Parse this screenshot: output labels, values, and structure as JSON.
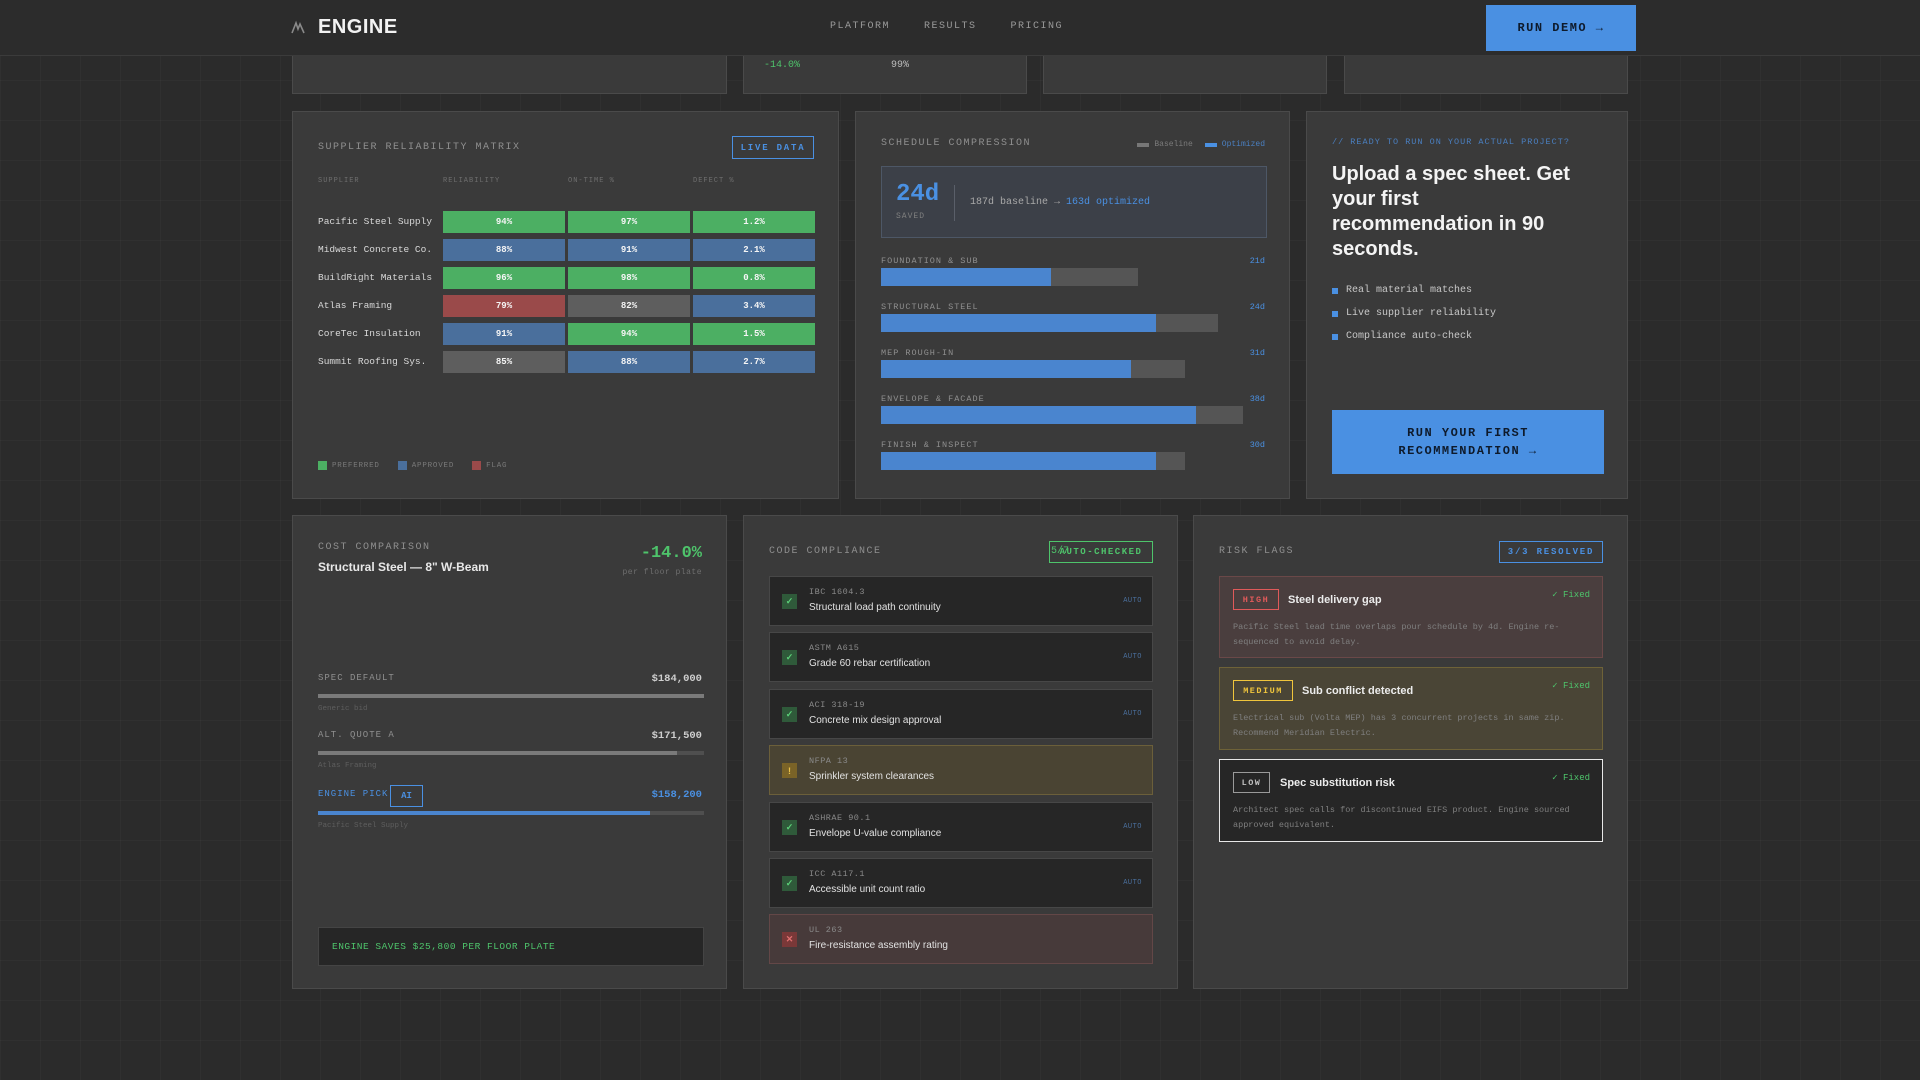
{
  "header": {
    "logo": "ENGINE",
    "nav": [
      "PLATFORM",
      "RESULTS",
      "PRICING"
    ],
    "demo_button": "RUN DEMO →"
  },
  "top_strip": {
    "change": "-14.0%",
    "percent": "99%"
  },
  "supplier_matrix": {
    "title": "SUPPLIER RELIABILITY MATRIX",
    "badge": "LIVE DATA",
    "columns": [
      "SUPPLIER",
      "RELIABILITY",
      "ON-TIME %",
      "DEFECT %"
    ],
    "rows": [
      {
        "name": "Pacific Steel Supply",
        "cells": [
          {
            "v": "94%",
            "s": "green"
          },
          {
            "v": "97%",
            "s": "green"
          },
          {
            "v": "1.2%",
            "s": "green"
          }
        ]
      },
      {
        "name": "Midwest Concrete Co.",
        "cells": [
          {
            "v": "88%",
            "s": "blue"
          },
          {
            "v": "91%",
            "s": "blue"
          },
          {
            "v": "2.1%",
            "s": "blue"
          }
        ]
      },
      {
        "name": "BuildRight Materials",
        "cells": [
          {
            "v": "96%",
            "s": "green"
          },
          {
            "v": "98%",
            "s": "green"
          },
          {
            "v": "0.8%",
            "s": "green"
          }
        ]
      },
      {
        "name": "Atlas Framing",
        "cells": [
          {
            "v": "79%",
            "s": "red"
          },
          {
            "v": "82%",
            "s": "gray"
          },
          {
            "v": "3.4%",
            "s": "blue"
          }
        ]
      },
      {
        "name": "CoreTec Insulation",
        "cells": [
          {
            "v": "91%",
            "s": "blue"
          },
          {
            "v": "94%",
            "s": "green"
          },
          {
            "v": "1.5%",
            "s": "green"
          }
        ]
      },
      {
        "name": "Summit Roofing Sys.",
        "cells": [
          {
            "v": "85%",
            "s": "gray"
          },
          {
            "v": "88%",
            "s": "blue"
          },
          {
            "v": "2.7%",
            "s": "blue"
          }
        ]
      }
    ],
    "legend": [
      {
        "label": "PREFERRED",
        "color": "#4caf63"
      },
      {
        "label": "APPROVED",
        "color": "#4a6f9c"
      },
      {
        "label": "FLAG",
        "color": "#9a4a4a"
      }
    ]
  },
  "schedule": {
    "title": "SCHEDULE COMPRESSION",
    "legend_baseline": "Baseline",
    "legend_optimized": "Optimized",
    "saved_value": "24d",
    "saved_label": "SAVED",
    "baseline_text": "187d baseline →",
    "optimized_text": "163d optimized",
    "phases": [
      {
        "label": "FOUNDATION & SUB",
        "days": "21d",
        "baseline": 0.71,
        "optimized": 0.47
      },
      {
        "label": "STRUCTURAL STEEL",
        "days": "24d",
        "baseline": 0.93,
        "optimized": 0.76
      },
      {
        "label": "MEP ROUGH-IN",
        "days": "31d",
        "baseline": 0.84,
        "optimized": 0.69
      },
      {
        "label": "ENVELOPE & FACADE",
        "days": "38d",
        "baseline": 1.0,
        "optimized": 0.87
      },
      {
        "label": "FINISH & INSPECT",
        "days": "30d",
        "baseline": 0.84,
        "optimized": 0.76
      }
    ]
  },
  "cta": {
    "kicker": "// READY TO RUN ON YOUR ACTUAL PROJECT?",
    "headline": "Upload a spec sheet. Get your first recommendation in 90 seconds.",
    "bullets": [
      "Real material matches",
      "Live supplier reliability",
      "Compliance auto-check"
    ],
    "button_line1": "RUN YOUR FIRST",
    "button_line2": "RECOMMENDATION →"
  },
  "cost": {
    "title": "COST COMPARISON",
    "subtitle": "Structural Steel — 8\" W-Beam",
    "change": "-14.0%",
    "unit": "per floor plate",
    "rows": [
      {
        "label": "SPEC DEFAULT",
        "value": "$184,000",
        "source": "Generic bid",
        "fill": 1.0
      },
      {
        "label": "ALT. QUOTE A",
        "value": "$171,500",
        "source": "Atlas Framing",
        "fill": 0.93
      },
      {
        "label": "ENGINE PICK",
        "value": "$158,200",
        "source": "Pacific Steel Supply",
        "fill": 0.86,
        "badge": "AI"
      }
    ],
    "savings": "ENGINE SAVES $25,800 PER FLOOR PLATE"
  },
  "compliance": {
    "title": "CODE COMPLIANCE",
    "count": "5/7",
    "badge": "AUTO-CHECKED",
    "items": [
      {
        "code": "IBC 1604.3",
        "name": "Structural load path continuity",
        "status": "pass",
        "mark": "✓",
        "auto": "AUTO"
      },
      {
        "code": "ASTM A615",
        "name": "Grade 60 rebar certification",
        "status": "pass",
        "mark": "✓",
        "auto": "AUTO"
      },
      {
        "code": "ACI 318-19",
        "name": "Concrete mix design approval",
        "status": "pass",
        "mark": "✓",
        "auto": "AUTO"
      },
      {
        "code": "NFPA 13",
        "name": "Sprinkler system clearances",
        "status": "warn",
        "mark": "!",
        "auto": ""
      },
      {
        "code": "ASHRAE 90.1",
        "name": "Envelope U-value compliance",
        "status": "pass",
        "mark": "✓",
        "auto": "AUTO"
      },
      {
        "code": "ICC A117.1",
        "name": "Accessible unit count ratio",
        "status": "pass",
        "mark": "✓",
        "auto": "AUTO"
      },
      {
        "code": "UL 263",
        "name": "Fire-resistance assembly rating",
        "status": "fail",
        "mark": "✕",
        "auto": ""
      }
    ]
  },
  "risk": {
    "title": "RISK FLAGS",
    "badge": "3/3 RESOLVED",
    "items": [
      {
        "severity": "HIGH",
        "level": "high",
        "title": "Steel delivery gap",
        "status": "✓ Fixed",
        "desc": "Pacific Steel lead time overlaps pour schedule by 4d. Engine re-sequenced to avoid delay."
      },
      {
        "severity": "MEDIUM",
        "level": "med",
        "title": "Sub conflict detected",
        "status": "✓ Fixed",
        "desc": "Electrical sub (Volta MEP) has 3 concurrent projects in same zip. Recommend Meridian Electric."
      },
      {
        "severity": "LOW",
        "level": "low",
        "title": "Spec substitution risk",
        "status": "✓ Fixed",
        "desc": "Architect spec calls for discontinued EIFS product. Engine sourced approved equivalent."
      }
    ]
  }
}
